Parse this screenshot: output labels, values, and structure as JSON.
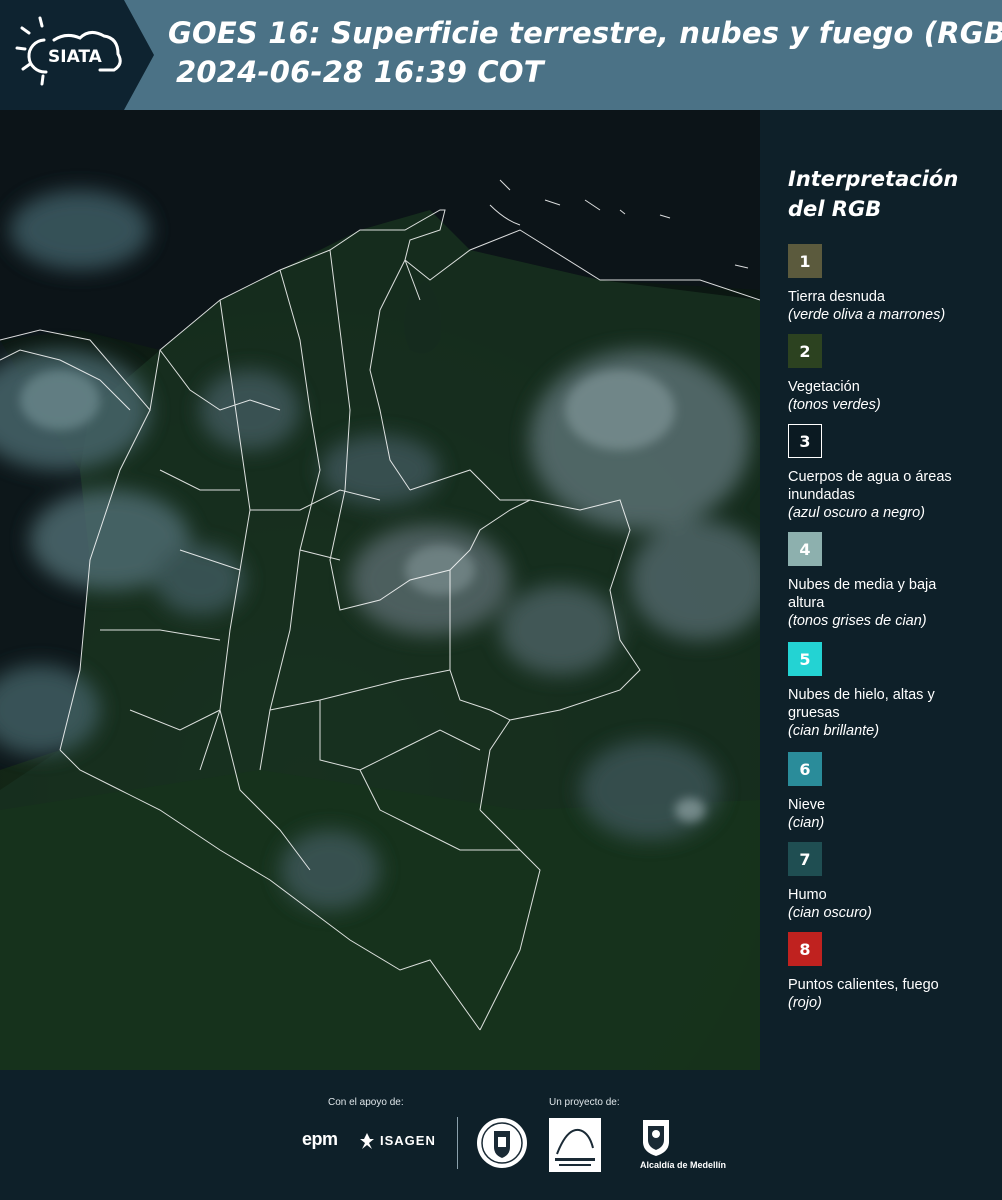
{
  "header": {
    "title_line1": "GOES 16: Superficie terrestre, nubes y fuego (RGB)",
    "title_line2": "2024-06-28 16:39 COT",
    "logo_text": "SIATA"
  },
  "legend": {
    "title_line1": "Interpretación",
    "title_line2": "del RGB",
    "items": [
      {
        "number": "1",
        "label": "Tierra desnuda",
        "sub": "(verde oliva a marrones)",
        "color": "#5b5a3d"
      },
      {
        "number": "2",
        "label": "Vegetación",
        "sub": "(tonos verdes)",
        "color": "#2c4220"
      },
      {
        "number": "3",
        "label": "Cuerpos de agua o áreas inundadas",
        "sub": "(azul oscuro a negro)",
        "color": "#0b1a22"
      },
      {
        "number": "4",
        "label": "Nubes de media y baja altura",
        "sub": "(tonos grises de cian)",
        "color": "#8db0ae"
      },
      {
        "number": "5",
        "label": "Nubes de hielo, altas y gruesas",
        "sub": "(cian brillante)",
        "color": "#23d3d3"
      },
      {
        "number": "6",
        "label": "Nieve",
        "sub": "(cian)",
        "color": "#2a8c9a"
      },
      {
        "number": "7",
        "label": "Humo",
        "sub": "(cian oscuro)",
        "color": "#1f4e52"
      },
      {
        "number": "8",
        "label": "Puntos calientes, fuego",
        "sub": "(rojo)",
        "color": "#c0221f"
      }
    ]
  },
  "footer": {
    "support_label": "Con el apoyo de:",
    "project_label": "Un proyecto de:",
    "epm": "epm",
    "isagen": "ISAGEN",
    "alcaldia": "Alcaldía de Medellín"
  }
}
